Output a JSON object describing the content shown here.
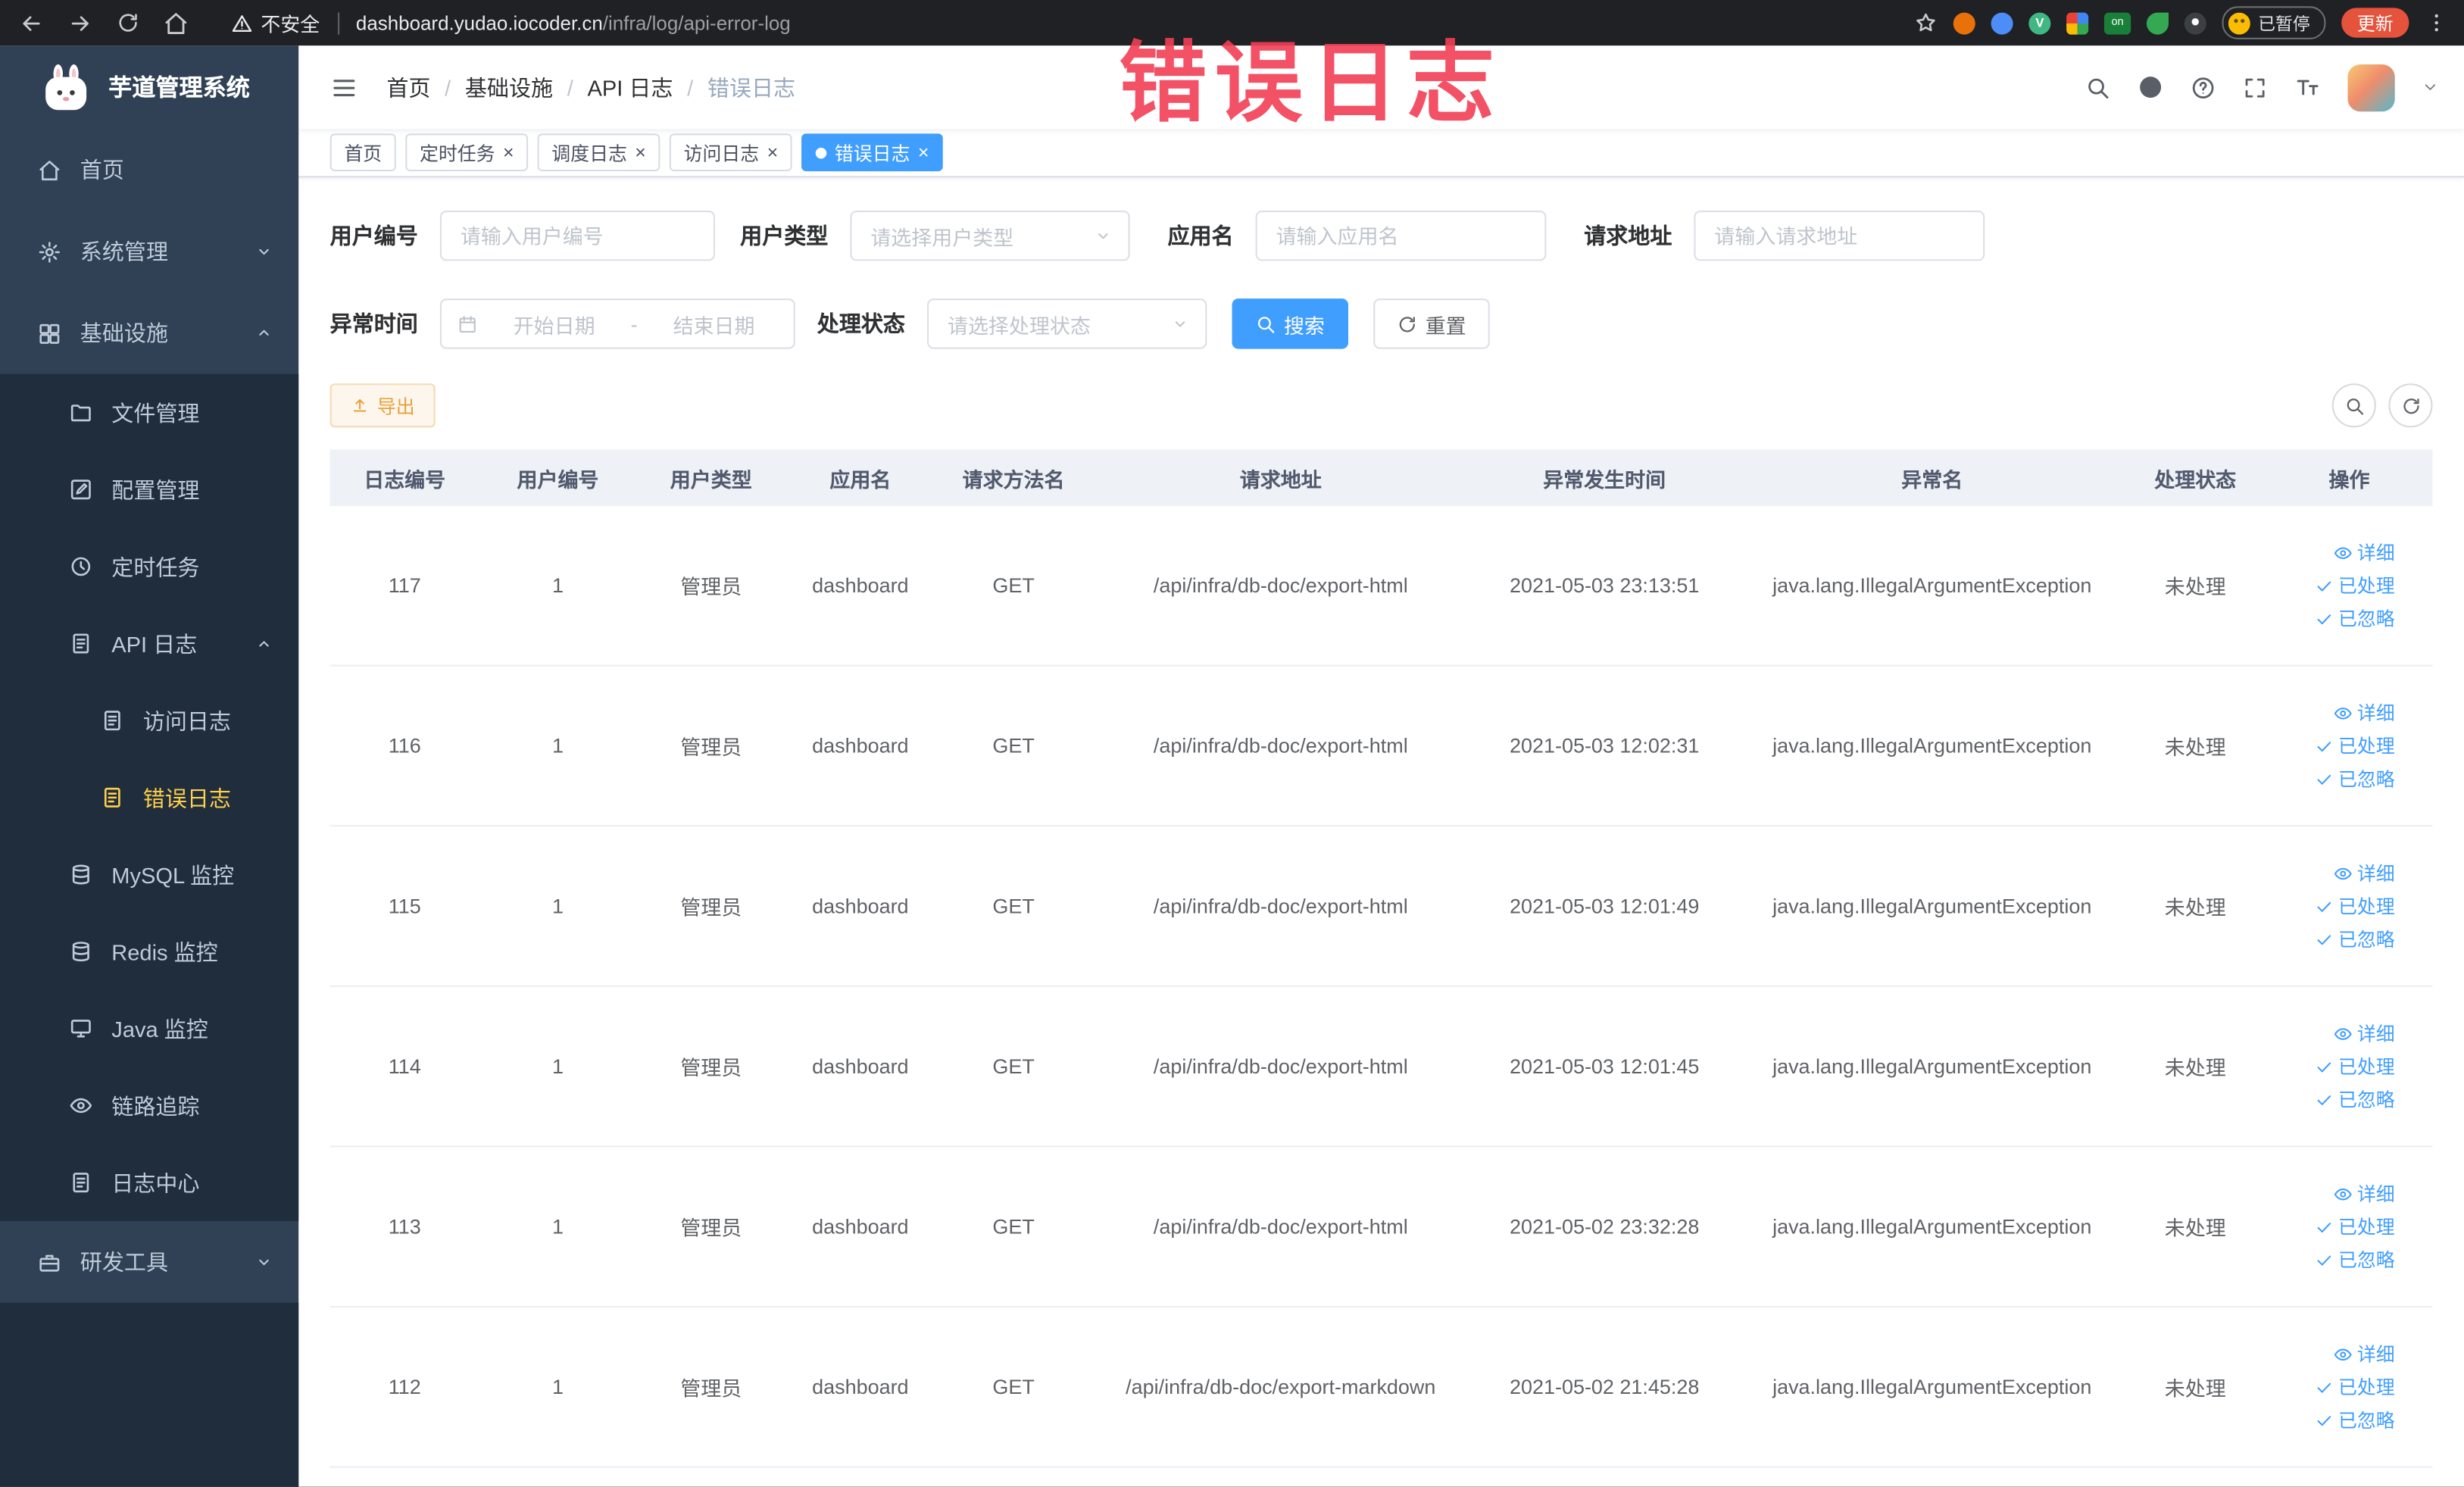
{
  "browser": {
    "security_label": "不安全",
    "url_domain": "dashboard.yudao.iocoder.cn",
    "url_path": "/infra/log/api-error-log",
    "vue_badge": "V",
    "on_badge": "on",
    "paused_label": "已暂停",
    "update_label": "更新"
  },
  "watermark": "错误日志",
  "sidebar": {
    "app_title": "芋道管理系统",
    "items": [
      {
        "label": "首页"
      },
      {
        "label": "系统管理"
      },
      {
        "label": "基础设施"
      },
      {
        "label": "文件管理"
      },
      {
        "label": "配置管理"
      },
      {
        "label": "定时任务"
      },
      {
        "label": "API 日志"
      },
      {
        "label": "访问日志"
      },
      {
        "label": "错误日志"
      },
      {
        "label": "MySQL 监控"
      },
      {
        "label": "Redis 监控"
      },
      {
        "label": "Java 监控"
      },
      {
        "label": "链路追踪"
      },
      {
        "label": "日志中心"
      },
      {
        "label": "研发工具"
      }
    ]
  },
  "navbar": {
    "breadcrumb": [
      {
        "label": "首页"
      },
      {
        "label": "基础设施"
      },
      {
        "label": "API 日志"
      },
      {
        "label": "错误日志"
      }
    ]
  },
  "tags": [
    {
      "label": "首页"
    },
    {
      "label": "定时任务"
    },
    {
      "label": "调度日志"
    },
    {
      "label": "访问日志"
    },
    {
      "label": "错误日志"
    }
  ],
  "filters": {
    "user_id_label": "用户编号",
    "user_id_placeholder": "请输入用户编号",
    "user_type_label": "用户类型",
    "user_type_placeholder": "请选择用户类型",
    "app_name_label": "应用名",
    "app_name_placeholder": "请输入应用名",
    "request_url_label": "请求地址",
    "request_url_placeholder": "请输入请求地址",
    "exception_time_label": "异常时间",
    "start_date_placeholder": "开始日期",
    "range_separator": "-",
    "end_date_placeholder": "结束日期",
    "process_status_label": "处理状态",
    "process_status_placeholder": "请选择处理状态",
    "search_label": "搜索",
    "reset_label": "重置"
  },
  "toolbar": {
    "export_label": "导出"
  },
  "table": {
    "headers": [
      "日志编号",
      "用户编号",
      "用户类型",
      "应用名",
      "请求方法名",
      "请求地址",
      "异常发生时间",
      "异常名",
      "处理状态",
      "操作"
    ],
    "actions": {
      "detail": "详细",
      "processed": "已处理",
      "ignored": "已忽略"
    },
    "rows": [
      {
        "id": "117",
        "user_id": "1",
        "user_type": "管理员",
        "app": "dashboard",
        "method": "GET",
        "url": "/api/infra/db-doc/export-html",
        "time": "2021-05-03 23:13:51",
        "exception": "java.lang.IllegalArgumentException",
        "status": "未处理"
      },
      {
        "id": "116",
        "user_id": "1",
        "user_type": "管理员",
        "app": "dashboard",
        "method": "GET",
        "url": "/api/infra/db-doc/export-html",
        "time": "2021-05-03 12:02:31",
        "exception": "java.lang.IllegalArgumentException",
        "status": "未处理"
      },
      {
        "id": "115",
        "user_id": "1",
        "user_type": "管理员",
        "app": "dashboard",
        "method": "GET",
        "url": "/api/infra/db-doc/export-html",
        "time": "2021-05-03 12:01:49",
        "exception": "java.lang.IllegalArgumentException",
        "status": "未处理"
      },
      {
        "id": "114",
        "user_id": "1",
        "user_type": "管理员",
        "app": "dashboard",
        "method": "GET",
        "url": "/api/infra/db-doc/export-html",
        "time": "2021-05-03 12:01:45",
        "exception": "java.lang.IllegalArgumentException",
        "status": "未处理"
      },
      {
        "id": "113",
        "user_id": "1",
        "user_type": "管理员",
        "app": "dashboard",
        "method": "GET",
        "url": "/api/infra/db-doc/export-html",
        "time": "2021-05-02 23:32:28",
        "exception": "java.lang.IllegalArgumentException",
        "status": "未处理"
      },
      {
        "id": "112",
        "user_id": "1",
        "user_type": "管理员",
        "app": "dashboard",
        "method": "GET",
        "url": "/api/infra/db-doc/export-markdown",
        "time": "2021-05-02 21:45:28",
        "exception": "java.lang.IllegalArgumentException",
        "status": "未处理"
      }
    ]
  }
}
